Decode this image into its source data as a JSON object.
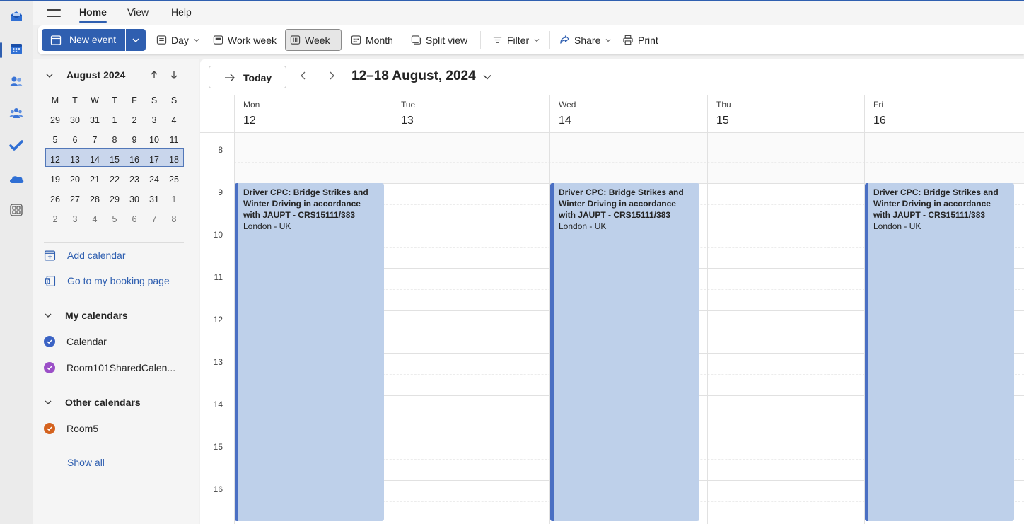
{
  "menu": {
    "tabs": [
      "Home",
      "View",
      "Help"
    ]
  },
  "toolbar": {
    "new_event": "New event",
    "day": "Day",
    "work_week": "Work week",
    "week": "Week",
    "month": "Month",
    "split_view": "Split view",
    "filter": "Filter",
    "share": "Share",
    "print": "Print"
  },
  "mini_calendar": {
    "title": "August 2024",
    "weekdays": [
      "M",
      "T",
      "W",
      "T",
      "F",
      "S",
      "S"
    ],
    "weeks": [
      [
        "29",
        "30",
        "31",
        "1",
        "2",
        "3",
        "4"
      ],
      [
        "5",
        "6",
        "7",
        "8",
        "9",
        "10",
        "11"
      ],
      [
        "12",
        "13",
        "14",
        "15",
        "16",
        "17",
        "18"
      ],
      [
        "19",
        "20",
        "21",
        "22",
        "23",
        "24",
        "25"
      ],
      [
        "26",
        "27",
        "28",
        "29",
        "30",
        "31",
        "1"
      ],
      [
        "2",
        "3",
        "4",
        "5",
        "6",
        "7",
        "8"
      ]
    ]
  },
  "left_panel": {
    "add_calendar": "Add calendar",
    "booking_page": "Go to my booking page",
    "my_calendars": "My calendars",
    "calendar": "Calendar",
    "room101": "Room101SharedCalen...",
    "other_calendars": "Other calendars",
    "room5": "Room5",
    "show_all": "Show all"
  },
  "colors": {
    "accent": "#2f5fb0",
    "calendar": "#3b63c4",
    "room101": "#9b4fc7",
    "room5": "#d4621e",
    "event_bg": "#bed0ea",
    "event_bar": "#4a6fc3"
  },
  "week_view": {
    "today": "Today",
    "range": "12–18 August, 2024",
    "days": [
      {
        "name": "Mon",
        "num": "12"
      },
      {
        "name": "Tue",
        "num": "13"
      },
      {
        "name": "Wed",
        "num": "14"
      },
      {
        "name": "Thu",
        "num": "15"
      },
      {
        "name": "Fri",
        "num": "16"
      }
    ],
    "hours": [
      "8",
      "9",
      "10",
      "11",
      "12",
      "13",
      "14",
      "15",
      "16"
    ],
    "event": {
      "title": "Driver CPC: Bridge Strikes and Winter Driving in accordance with JAUPT - CRS15111/383",
      "location": "London - UK"
    }
  }
}
